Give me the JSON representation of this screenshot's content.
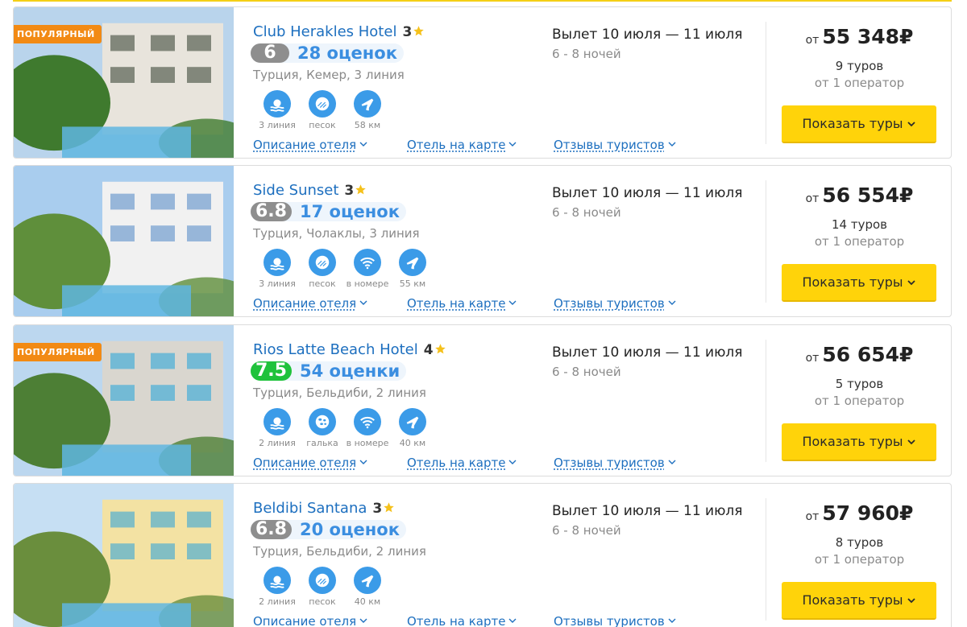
{
  "popular_label": "ПОПУЛЯРНЫЙ",
  "colors": {
    "accent_blue": "#1d6fbf",
    "button_yellow": "#ffd30a",
    "badge_orange": "#f28a14",
    "score_green": "#1fc23b",
    "score_gray": "#8e8e8e",
    "icon_blue": "#3b9be8"
  },
  "hotels": [
    {
      "popular": true,
      "name": "Club Herakles Hotel",
      "stars": "3",
      "score": "6",
      "score_color": "gray",
      "reviews": "28 оценок",
      "location": "Турция, Кемер, 3 линия",
      "features": [
        {
          "icon": "beach-line-icon",
          "label": "3 линия"
        },
        {
          "icon": "sand-icon",
          "label": "песок"
        },
        {
          "icon": "airport-distance-icon",
          "label": "58 км"
        }
      ],
      "links": {
        "description": "Описание отеля",
        "map": "Отель на карте",
        "reviews": "Отзывы туристов"
      },
      "flight": {
        "dates": "Вылет 10 июля — 11 июля",
        "nights": "6 - 8 ночей"
      },
      "price": {
        "from": "от",
        "value": "55 348₽",
        "tours": "9 туров",
        "operators": "от 1 оператор"
      },
      "button": "Показать туры"
    },
    {
      "popular": false,
      "name": "Side Sunset",
      "stars": "3",
      "score": "6.8",
      "score_color": "gray",
      "reviews": "17 оценок",
      "location": "Турция, Чолаклы, 3 линия",
      "features": [
        {
          "icon": "beach-line-icon",
          "label": "3 линия"
        },
        {
          "icon": "sand-icon",
          "label": "песок"
        },
        {
          "icon": "wifi-icon",
          "label": "в номере"
        },
        {
          "icon": "airport-distance-icon",
          "label": "55 км"
        }
      ],
      "links": {
        "description": "Описание отеля",
        "map": "Отель на карте",
        "reviews": "Отзывы туристов"
      },
      "flight": {
        "dates": "Вылет 10 июля — 11 июля",
        "nights": "6 - 8 ночей"
      },
      "price": {
        "from": "от",
        "value": "56 554₽",
        "tours": "14 туров",
        "operators": "от 1 оператор"
      },
      "button": "Показать туры"
    },
    {
      "popular": true,
      "name": "Rios Latte Beach Hotel",
      "stars": "4",
      "score": "7.5",
      "score_color": "green",
      "reviews": "54 оценки",
      "location": "Турция, Бельдиби, 2 линия",
      "features": [
        {
          "icon": "beach-line-icon",
          "label": "2 линия"
        },
        {
          "icon": "pebble-icon",
          "label": "галька"
        },
        {
          "icon": "wifi-icon",
          "label": "в номере"
        },
        {
          "icon": "airport-distance-icon",
          "label": "40 км"
        }
      ],
      "links": {
        "description": "Описание отеля",
        "map": "Отель на карте",
        "reviews": "Отзывы туристов"
      },
      "flight": {
        "dates": "Вылет 10 июля — 11 июля",
        "nights": "6 - 8 ночей"
      },
      "price": {
        "from": "от",
        "value": "56 654₽",
        "tours": "5 туров",
        "operators": "от 1 оператор"
      },
      "button": "Показать туры"
    },
    {
      "popular": false,
      "name": "Beldibi Santana",
      "stars": "3",
      "score": "6.8",
      "score_color": "gray",
      "reviews": "20 оценок",
      "location": "Турция, Бельдиби, 2 линия",
      "features": [
        {
          "icon": "beach-line-icon",
          "label": "2 линия"
        },
        {
          "icon": "sand-icon",
          "label": "песок"
        },
        {
          "icon": "airport-distance-icon",
          "label": "40 км"
        }
      ],
      "links": {
        "description": "Описание отеля",
        "map": "Отель на карте",
        "reviews": "Отзывы туристов"
      },
      "flight": {
        "dates": "Вылет 10 июля — 11 июля",
        "nights": "6 - 8 ночей"
      },
      "price": {
        "from": "от",
        "value": "57 960₽",
        "tours": "8 туров",
        "operators": "от 1 оператор"
      },
      "button": "Показать туры"
    }
  ]
}
